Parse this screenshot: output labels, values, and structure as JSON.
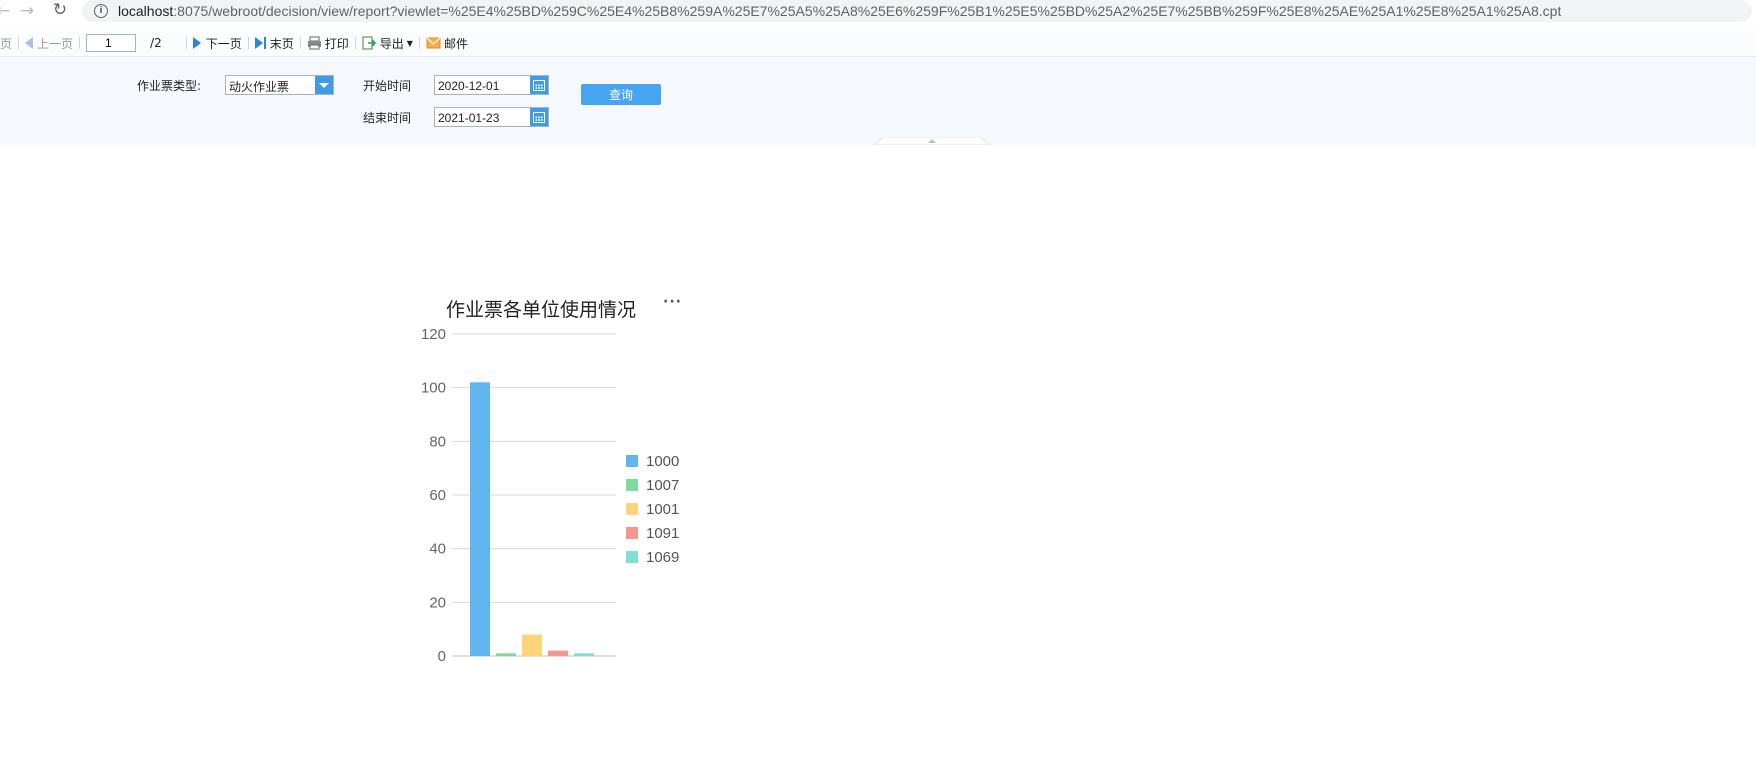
{
  "browser": {
    "url_host": "localhost",
    "url_rest": ":8075/webroot/decision/view/report?viewlet=%25E4%25BD%259C%25E4%25B8%259A%25E7%25A5%25A8%25E6%259F%25B1%25E5%25BD%25A2%25E7%25BB%259F%25E8%25AE%25A1%25E8%25A1%25A8.cpt"
  },
  "toolbar": {
    "first_page": "首页",
    "prev_page": "上一页",
    "current_page": "1",
    "total_pages": "/2",
    "next_page": "下一页",
    "last_page": "末页",
    "print": "打印",
    "export": "导出",
    "mail": "邮件"
  },
  "params": {
    "ticket_type_label": "作业票类型:",
    "ticket_type_value": "动火作业票",
    "start_label": "开始时间",
    "start_value": "2020-12-01",
    "end_label": "结束时间",
    "end_value": "2021-01-23",
    "query_label": "查询"
  },
  "chart_data": {
    "type": "bar",
    "title": "作业票各单位使用情况",
    "menu_glyph": "···",
    "categories": [
      "1000",
      "1007",
      "1001",
      "1091",
      "1069"
    ],
    "values": [
      102,
      1,
      8,
      2,
      1
    ],
    "colors": [
      "#62b6f0",
      "#7fd99a",
      "#ffd57a",
      "#f6978c",
      "#7fdfd5"
    ],
    "ylim": [
      0,
      120
    ],
    "yticks": [
      "0",
      "20",
      "40",
      "60",
      "80",
      "100",
      "120"
    ],
    "grid": true,
    "legend": "right"
  }
}
